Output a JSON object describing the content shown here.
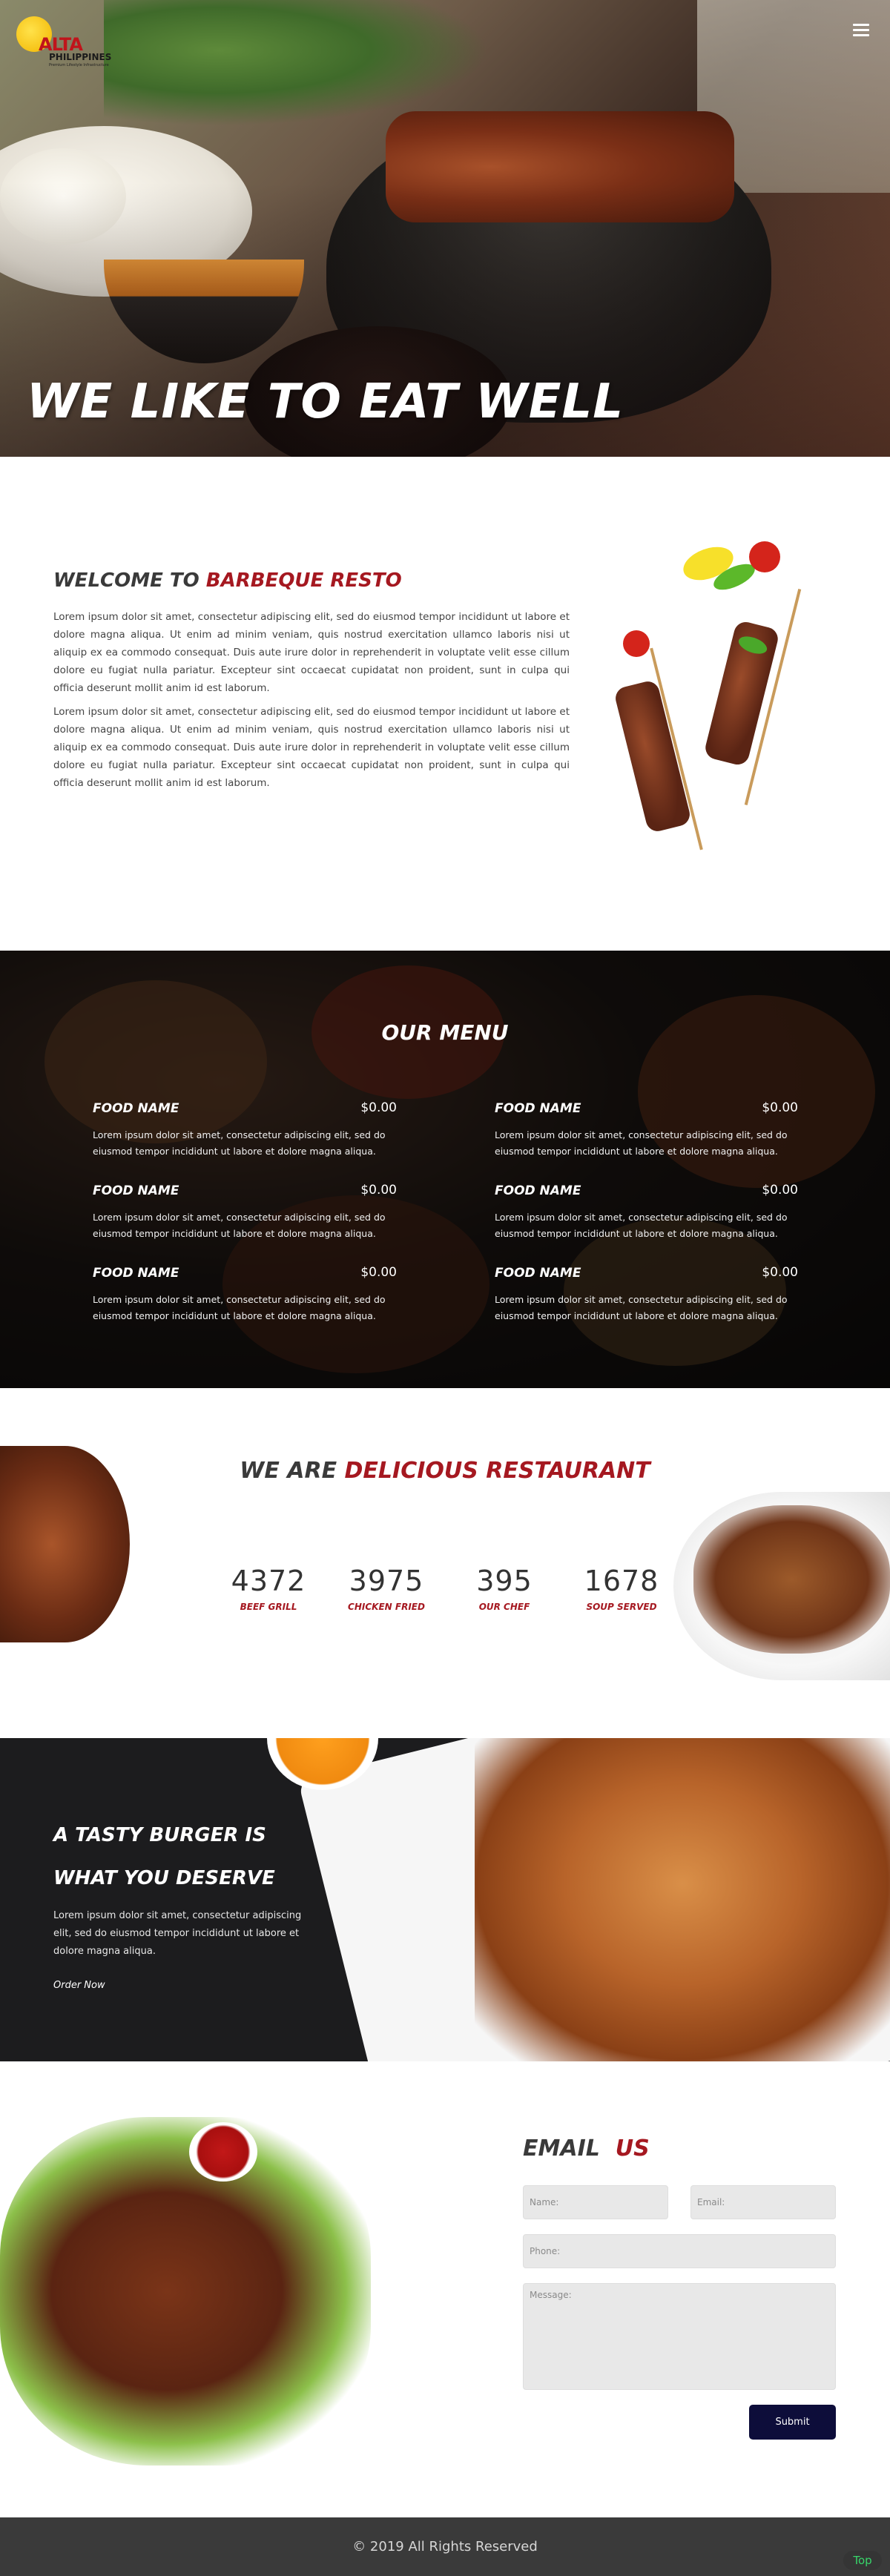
{
  "brand": {
    "logo_name": "ALTA",
    "logo_sub": "PHILIPPINES",
    "logo_tag": "Premium Lifestyle Infrastructure"
  },
  "nav": {
    "menu_icon": "hamburger-icon"
  },
  "hero": {
    "title": "WE LIKE TO EAT WELL"
  },
  "welcome": {
    "heading_prefix": "WELCOME TO",
    "heading_accent": "BARBEQUE RESTO",
    "paragraphs": [
      "Lorem ipsum dolor sit amet, consectetur adipiscing elit, sed do eiusmod tempor incididunt ut labore et dolore magna aliqua. Ut enim ad minim veniam, quis nostrud exercitation ullamco laboris nisi ut aliquip ex ea commodo consequat. Duis aute irure dolor in reprehenderit in voluptate velit esse cillum dolore eu fugiat nulla pariatur. Excepteur sint occaecat cupidatat non proident, sunt in culpa qui officia deserunt mollit anim id est laborum.",
      "Lorem ipsum dolor sit amet, consectetur adipiscing elit, sed do eiusmod tempor incididunt ut labore et dolore magna aliqua. Ut enim ad minim veniam, quis nostrud exercitation ullamco laboris nisi ut aliquip ex ea commodo consequat. Duis aute irure dolor in reprehenderit in voluptate velit esse cillum dolore eu fugiat nulla pariatur. Excepteur sint occaecat cupidatat non proident, sunt in culpa qui officia deserunt mollit anim id est laborum."
    ]
  },
  "menu": {
    "title": "OUR MENU",
    "items": [
      {
        "name": "FOOD NAME",
        "price": "$0.00",
        "desc": "Lorem ipsum dolor sit amet, consectetur adipiscing elit, sed do eiusmod tempor incididunt ut labore et dolore magna aliqua."
      },
      {
        "name": "FOOD NAME",
        "price": "$0.00",
        "desc": "Lorem ipsum dolor sit amet, consectetur adipiscing elit, sed do eiusmod tempor incididunt ut labore et dolore magna aliqua."
      },
      {
        "name": "FOOD NAME",
        "price": "$0.00",
        "desc": "Lorem ipsum dolor sit amet, consectetur adipiscing elit, sed do eiusmod tempor incididunt ut labore et dolore magna aliqua."
      },
      {
        "name": "FOOD NAME",
        "price": "$0.00",
        "desc": "Lorem ipsum dolor sit amet, consectetur adipiscing elit, sed do eiusmod tempor incididunt ut labore et dolore magna aliqua."
      },
      {
        "name": "FOOD NAME",
        "price": "$0.00",
        "desc": "Lorem ipsum dolor sit amet, consectetur adipiscing elit, sed do eiusmod tempor incididunt ut labore et dolore magna aliqua."
      },
      {
        "name": "FOOD NAME",
        "price": "$0.00",
        "desc": "Lorem ipsum dolor sit amet, consectetur adipiscing elit, sed do eiusmod tempor incididunt ut labore et dolore magna aliqua."
      }
    ]
  },
  "delicious": {
    "heading_prefix": "WE ARE",
    "heading_accent": "DELICIOUS RESTAURANT",
    "counters": [
      {
        "value": "4372",
        "label": "BEEF GRILL"
      },
      {
        "value": "3975",
        "label": "CHICKEN FRIED"
      },
      {
        "value": "395",
        "label": "OUR CHEF"
      },
      {
        "value": "1678",
        "label": "SOUP SERVED"
      }
    ]
  },
  "promo": {
    "title": "A TASTY BURGER IS WHAT YOU DESERVE",
    "text": "Lorem ipsum dolor sit amet, consectetur adipiscing elit, sed do eiusmod tempor incididunt ut labore et dolore magna aliqua.",
    "link": "Order Now"
  },
  "email": {
    "heading_prefix": "EMAIL",
    "heading_accent": "US",
    "name_placeholder": "Name:",
    "email_placeholder": "Email:",
    "phone_placeholder": "Phone:",
    "message_placeholder": "Message:",
    "submit_label": "Submit"
  },
  "footer": {
    "copyright": "© 2019 All Rights Reserved",
    "top_label": "Top"
  },
  "colors": {
    "accent": "#a51820",
    "submit": "#0d0d3a",
    "footer": "#3a3a3a",
    "top_link": "#37d66a"
  }
}
